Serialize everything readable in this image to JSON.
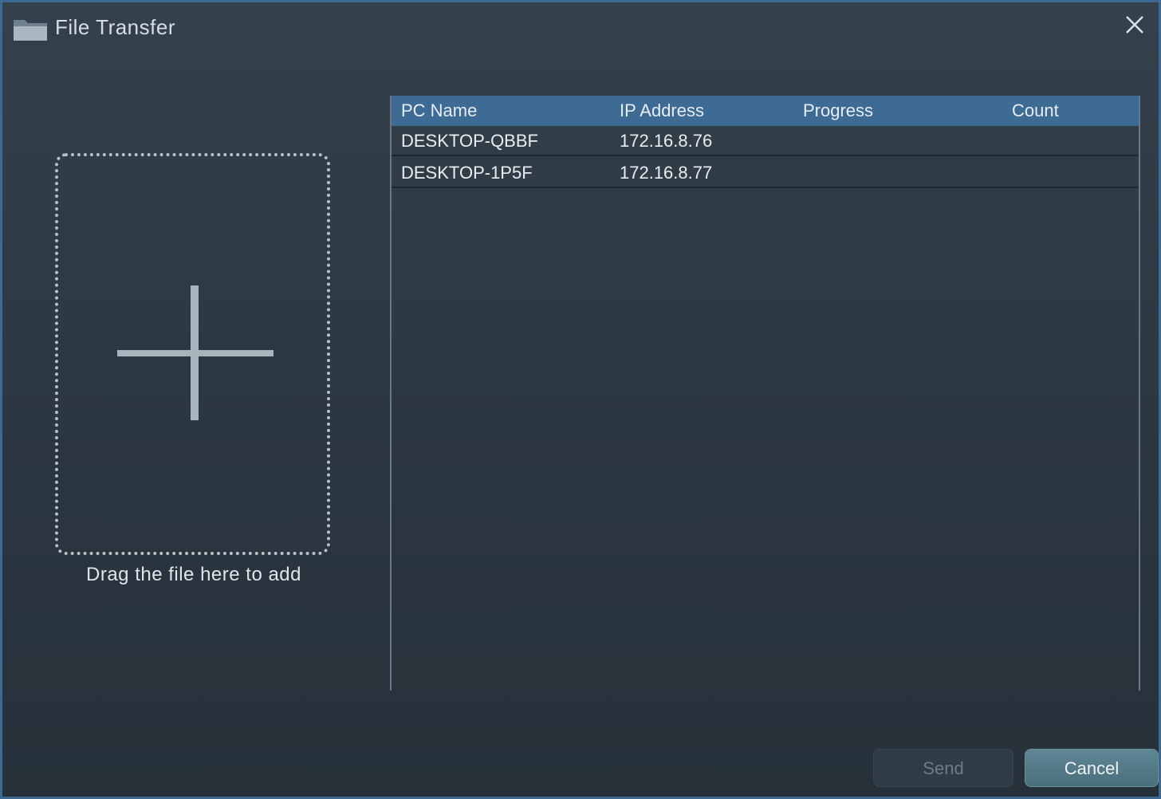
{
  "window": {
    "title": "File Transfer",
    "icons": {
      "app": "folder-icon",
      "close": "close-icon"
    }
  },
  "dropzone": {
    "label": "Drag the file here to add",
    "icon": "plus-icon"
  },
  "table": {
    "columns": [
      "PC Name",
      "IP Address",
      "Progress",
      "Count"
    ],
    "rows": [
      {
        "pc_name": "DESKTOP-QBBF",
        "ip_address": "172.16.8.76",
        "progress": "",
        "count": ""
      },
      {
        "pc_name": "DESKTOP-1P5F",
        "ip_address": "172.16.8.77",
        "progress": "",
        "count": ""
      }
    ]
  },
  "buttons": {
    "send_label": "Send",
    "cancel_label": "Cancel"
  },
  "colors": {
    "accent": "#3e6b94",
    "border": "#3d6a92",
    "background": "#2c3842",
    "cancel": "#5a808e"
  }
}
